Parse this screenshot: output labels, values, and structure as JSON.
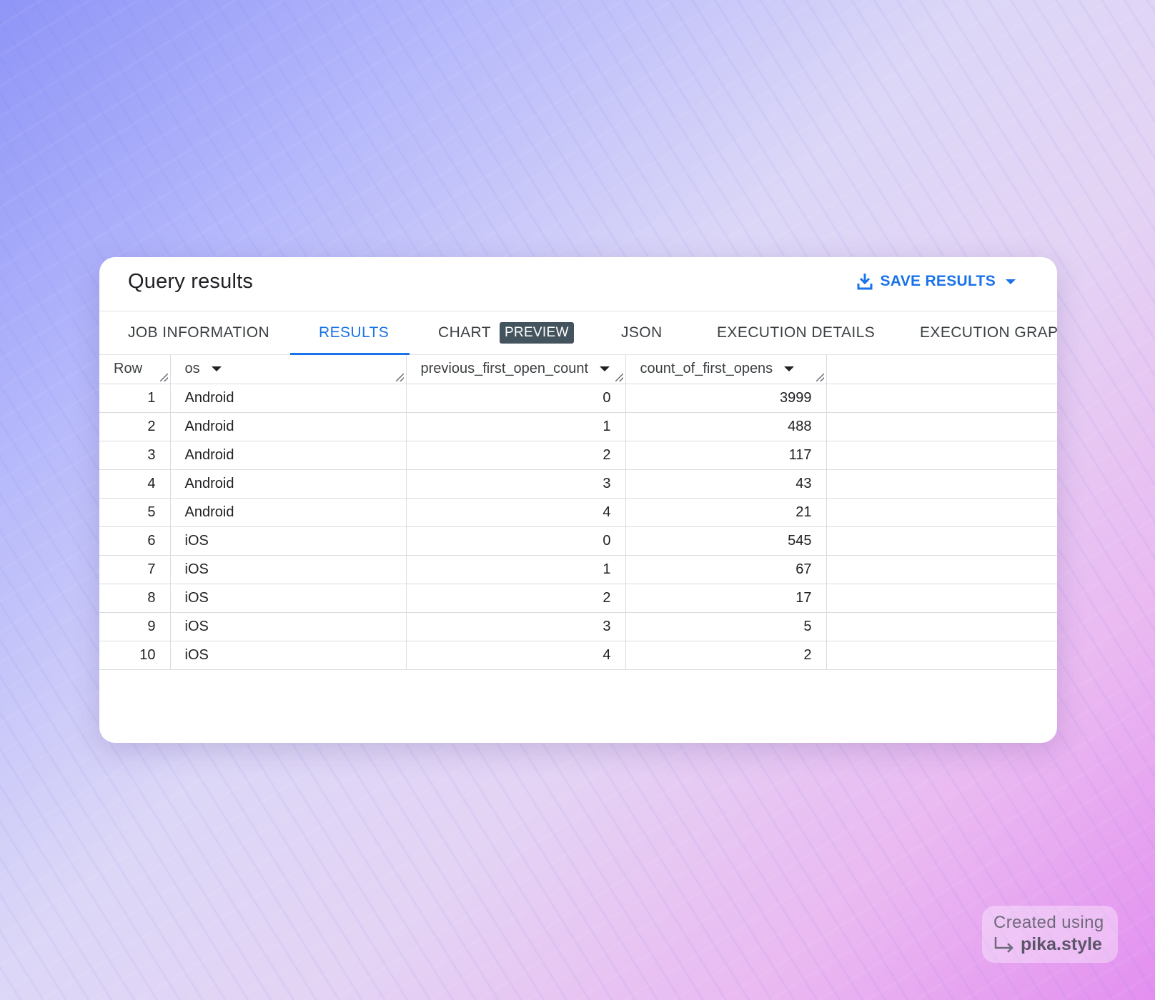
{
  "header": {
    "title": "Query results",
    "save_label": "SAVE RESULTS",
    "save_icon": "download-icon",
    "save_menu_icon": "caret-down-icon"
  },
  "tabs": [
    {
      "label": "JOB INFORMATION",
      "active": false
    },
    {
      "label": "RESULTS",
      "active": true
    },
    {
      "label": "CHART",
      "badge": "PREVIEW",
      "active": false
    },
    {
      "label": "JSON",
      "active": false
    },
    {
      "label": "EXECUTION DETAILS",
      "active": false
    },
    {
      "label": "EXECUTION GRAPH",
      "active": false
    }
  ],
  "table": {
    "columns": [
      {
        "key": "row",
        "label": "Row",
        "sortable": false
      },
      {
        "key": "os",
        "label": "os",
        "sortable": true
      },
      {
        "key": "previous_first_open_count",
        "label": "previous_first_open_count",
        "sortable": true
      },
      {
        "key": "count_of_first_opens",
        "label": "count_of_first_opens",
        "sortable": true
      }
    ],
    "rows": [
      {
        "row": "1",
        "os": "Android",
        "previous_first_open_count": "0",
        "count_of_first_opens": "3999"
      },
      {
        "row": "2",
        "os": "Android",
        "previous_first_open_count": "1",
        "count_of_first_opens": "488"
      },
      {
        "row": "3",
        "os": "Android",
        "previous_first_open_count": "2",
        "count_of_first_opens": "117"
      },
      {
        "row": "4",
        "os": "Android",
        "previous_first_open_count": "3",
        "count_of_first_opens": "43"
      },
      {
        "row": "5",
        "os": "Android",
        "previous_first_open_count": "4",
        "count_of_first_opens": "21"
      },
      {
        "row": "6",
        "os": "iOS",
        "previous_first_open_count": "0",
        "count_of_first_opens": "545"
      },
      {
        "row": "7",
        "os": "iOS",
        "previous_first_open_count": "1",
        "count_of_first_opens": "67"
      },
      {
        "row": "8",
        "os": "iOS",
        "previous_first_open_count": "2",
        "count_of_first_opens": "17"
      },
      {
        "row": "9",
        "os": "iOS",
        "previous_first_open_count": "3",
        "count_of_first_opens": "5"
      },
      {
        "row": "10",
        "os": "iOS",
        "previous_first_open_count": "4",
        "count_of_first_opens": "2"
      }
    ]
  },
  "watermark": {
    "line1": "Created using",
    "brand": "pika.style",
    "arrow_icon": "return-arrow-icon"
  },
  "colors": {
    "accent": "#1a73e8",
    "badge_bg": "#44545e",
    "text": "#202124"
  }
}
